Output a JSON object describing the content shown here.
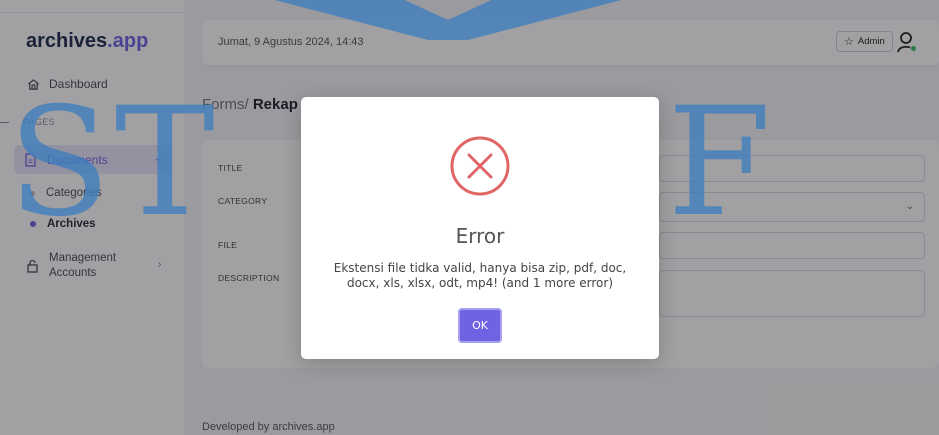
{
  "app": {
    "brand_main": "archives",
    "brand_accent": ".app"
  },
  "sidebar": {
    "dashboard": "Dashboard",
    "section_label": "PAGES",
    "documents": "Documents",
    "sub_items": [
      "Categories",
      "Archives"
    ],
    "management_line1": "Management",
    "management_line2": "Accounts"
  },
  "header": {
    "datetime": "Jumat, 9 Agustus 2024, 14:43",
    "admin_label": "Admin"
  },
  "breadcrumb": {
    "prefix": "Forms/ ",
    "current": "Rekap"
  },
  "form": {
    "labels": {
      "title": "TITLE",
      "category": "CATEGORY",
      "file": "FILE",
      "description": "DESCRIPTION"
    }
  },
  "footer": "Developed by archives.app",
  "watermark": {
    "left": "ST",
    "right": "NF"
  },
  "modal": {
    "title": "Error",
    "message": "Ekstensi file tidka valid, hanya bisa zip, pdf, doc, docx, xls, xlsx, odt, mp4! (and 1 more error)",
    "ok_label": "OK"
  },
  "colors": {
    "accent": "#6f63e3",
    "error": "#e06666",
    "online": "#3ec46d",
    "watermark": "#3e7dbf"
  }
}
